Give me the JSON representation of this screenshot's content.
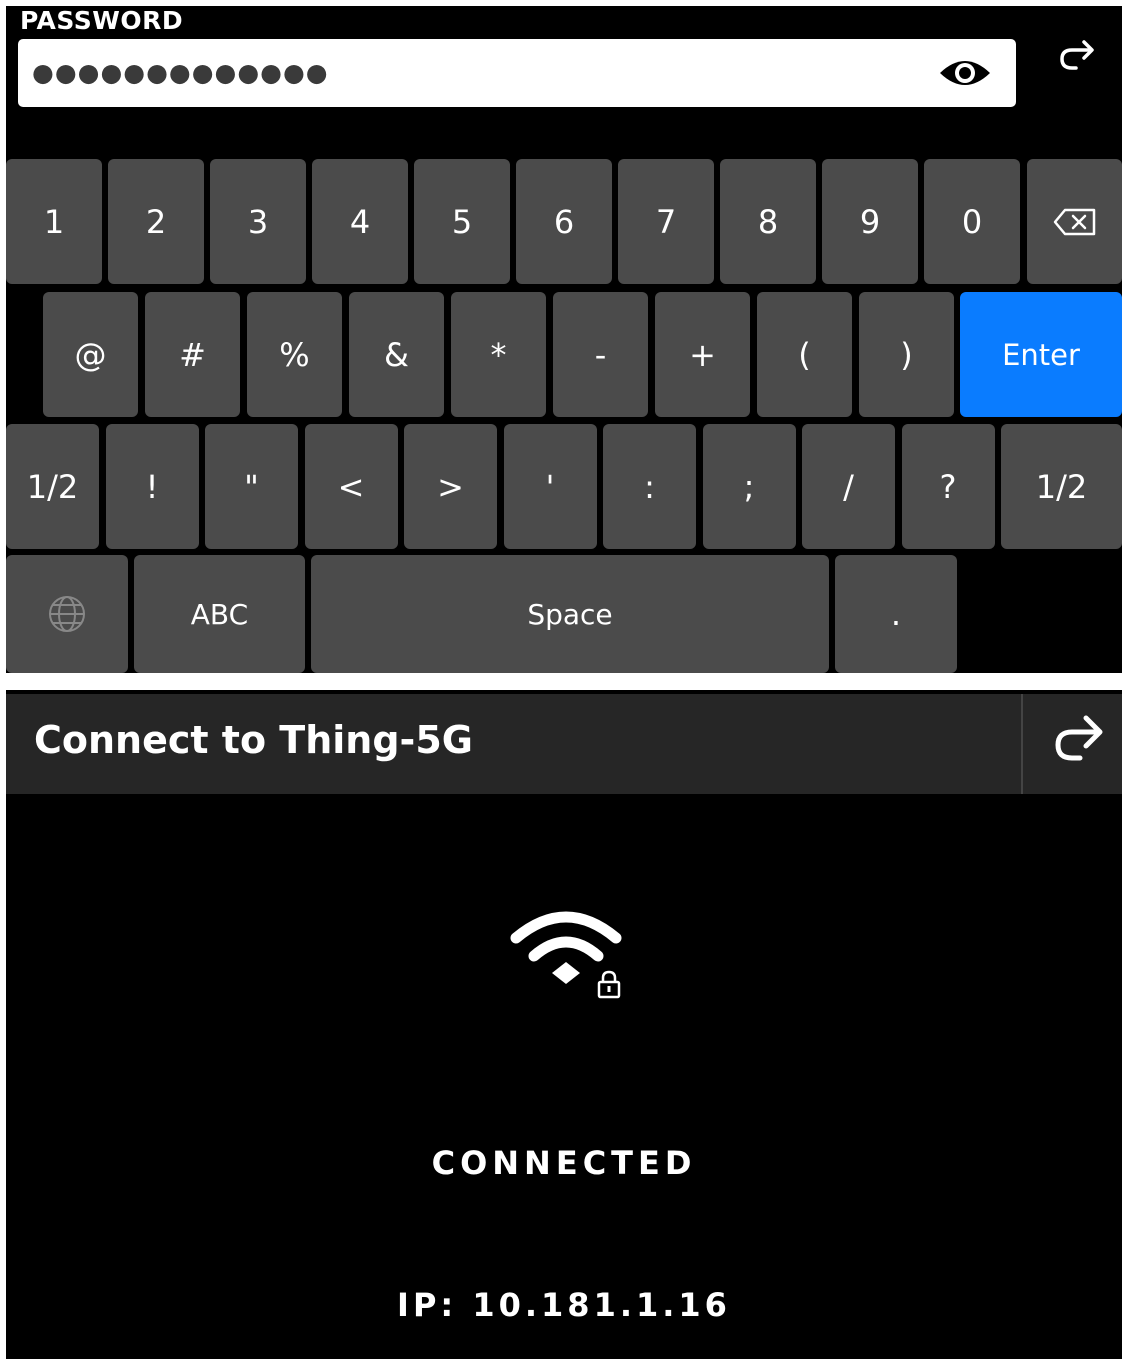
{
  "keyboard_screen": {
    "password_label": "PASSWORD",
    "password_value": "●●●●●●●●●●●●●",
    "icons": {
      "reveal": "eye-icon",
      "back": "forward-arrow-icon"
    },
    "keys": {
      "row1": [
        "1",
        "2",
        "3",
        "4",
        "5",
        "6",
        "7",
        "8",
        "9",
        "0"
      ],
      "backspace_icon": "backspace-icon",
      "row2": [
        "@",
        "#",
        "%",
        "&",
        "*",
        "-",
        "+",
        "(",
        ")"
      ],
      "enter": "Enter",
      "row3": [
        "1/2",
        "!",
        "\"",
        "<",
        ">",
        "'",
        ":",
        ";",
        "/",
        "?",
        "1/2"
      ],
      "globe_icon": "globe-icon",
      "abc": "ABC",
      "space": "Space",
      "period": "."
    },
    "colors": {
      "key": "#4b4b4b",
      "enter": "#0a7cff",
      "background": "#000000"
    }
  },
  "connect_screen": {
    "title": "Connect to Thing-5G",
    "back_icon": "forward-arrow-icon",
    "wifi_icon": "wifi-locked-icon",
    "status": "CONNECTED",
    "ip": "IP: 10.181.1.16"
  }
}
